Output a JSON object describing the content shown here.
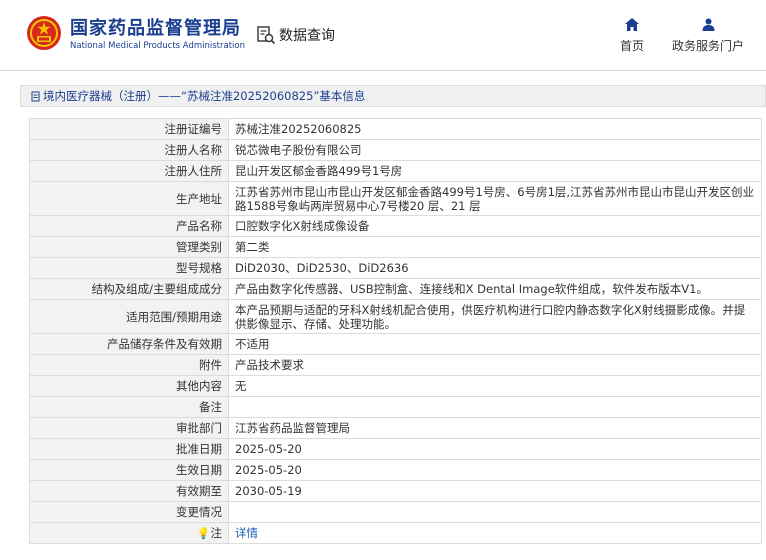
{
  "header": {
    "brand_cn": "国家药品监督管理局",
    "brand_en": "National Medical Products Administration",
    "query_label": "数据查询",
    "nav": {
      "home": "首页",
      "service": "政务服务门户"
    }
  },
  "breadcrumb": "境内医疗器械（注册）——“苏械注准20252060825”基本信息",
  "rows": [
    {
      "label": "注册证编号",
      "value": "苏械注准20252060825"
    },
    {
      "label": "注册人名称",
      "value": "锐芯微电子股份有限公司"
    },
    {
      "label": "注册人住所",
      "value": "昆山开发区郁金香路499号1号房"
    },
    {
      "label": "生产地址",
      "value": "江苏省苏州市昆山市昆山开发区郁金香路499号1号房、6号房1层,江苏省苏州市昆山市昆山开发区创业路1588号象屿两岸贸易中心7号楼20 层、21 层"
    },
    {
      "label": "产品名称",
      "value": "口腔数字化X射线成像设备"
    },
    {
      "label": "管理类别",
      "value": "第二类"
    },
    {
      "label": "型号规格",
      "value": "DiD2030、DiD2530、DiD2636"
    },
    {
      "label": "结构及组成/主要组成成分",
      "value": "产品由数字化传感器、USB控制盒、连接线和X Dental Image软件组成，软件发布版本V1。"
    },
    {
      "label": "适用范围/预期用途",
      "value": "本产品预期与适配的牙科X射线机配合使用，供医疗机构进行口腔内静态数字化X射线摄影成像。并提供影像显示、存储、处理功能。"
    },
    {
      "label": "产品储存条件及有效期",
      "value": "不适用"
    },
    {
      "label": "附件",
      "value": "产品技术要求"
    },
    {
      "label": "其他内容",
      "value": "无"
    },
    {
      "label": "备注",
      "value": ""
    },
    {
      "label": "审批部门",
      "value": "江苏省药品监督管理局"
    },
    {
      "label": "批准日期",
      "value": "2025-05-20"
    },
    {
      "label": "生效日期",
      "value": "2025-05-20"
    },
    {
      "label": "有效期至",
      "value": "2030-05-19"
    },
    {
      "label": "变更情况",
      "value": ""
    }
  ],
  "note": {
    "label": "注",
    "link": "详情"
  },
  "colors": {
    "brand": "#1a3f8f",
    "link": "#1a5fb4",
    "label_bg": "#f2f2f2"
  }
}
